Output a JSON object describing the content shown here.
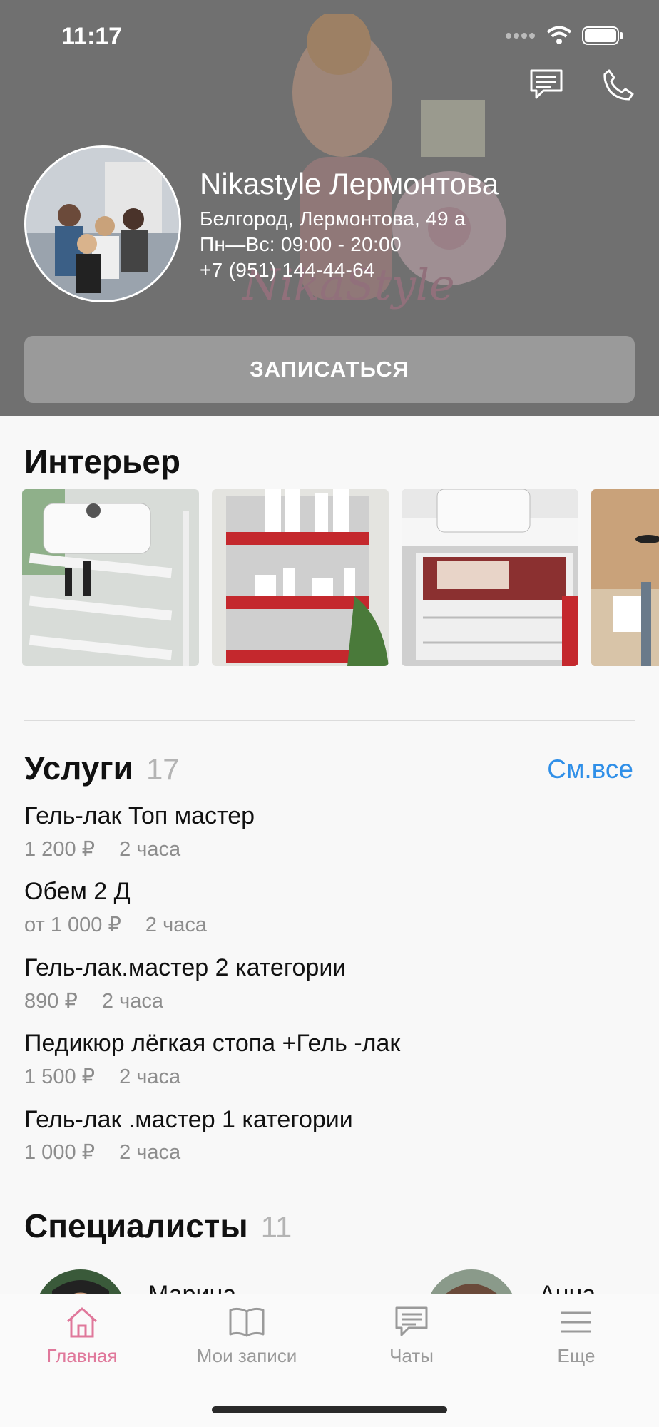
{
  "status_bar": {
    "time": "11:17"
  },
  "salon": {
    "name": "Nikastyle Лермонтова",
    "address": "Белгород, Лермонтова, 49 а",
    "hours": "Пн—Вс: 09:00 - 20:00",
    "phone": "+7 (951) 144-44-64",
    "book_label": "ЗАПИСАТЬСЯ"
  },
  "interior": {
    "title": "Интерьер"
  },
  "services": {
    "title": "Услуги",
    "count": "17",
    "see_all": "См.все",
    "items": [
      {
        "name": "Гель-лак Топ мастер",
        "price": "1 200 ₽",
        "duration": "2 часа"
      },
      {
        "name": "Обем 2 Д",
        "price": "от 1 000 ₽",
        "duration": "2 часа"
      },
      {
        "name": "Гель-лак.мастер 2 категории",
        "price": "890 ₽",
        "duration": "2 часа"
      },
      {
        "name": "Педикюр лёгкая стопа +Гель -лак",
        "price": "1 500 ₽",
        "duration": "2 часа"
      },
      {
        "name": "Гель-лак .мастер 1 категории",
        "price": "1 000 ₽",
        "duration": "2 часа"
      }
    ]
  },
  "specialists": {
    "title": "Специалисты",
    "count": "11",
    "items": [
      {
        "name": "Марина"
      },
      {
        "name": "Анна"
      }
    ]
  },
  "tabbar": {
    "items": [
      {
        "label": "Главная",
        "icon": "home-icon",
        "active": true
      },
      {
        "label": "Мои записи",
        "icon": "book-icon",
        "active": false
      },
      {
        "label": "Чаты",
        "icon": "chat-icon",
        "active": false
      },
      {
        "label": "Еще",
        "icon": "menu-icon",
        "active": false
      }
    ],
    "active_color": "#e0789b",
    "inactive_color": "#9a9a9a"
  },
  "colors": {
    "link": "#2f8fe8",
    "header_bg": "#707070"
  }
}
